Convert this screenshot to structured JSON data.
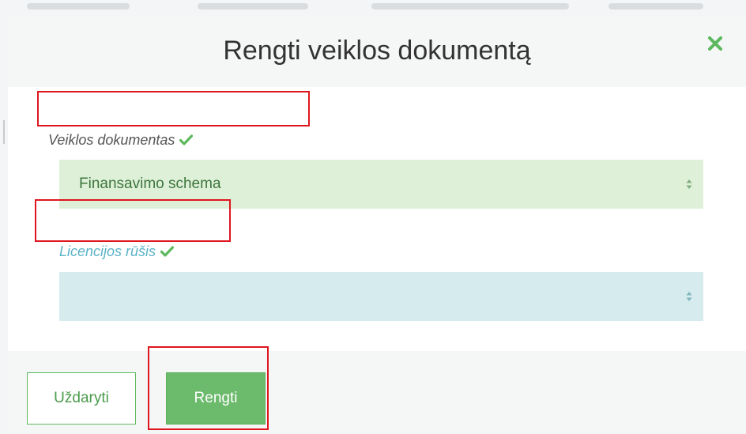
{
  "dialog": {
    "title": "Rengti veiklos dokumentą",
    "close_icon": "close-icon"
  },
  "fields": {
    "document": {
      "label": "Veiklos dokumentas",
      "value": "Finansavimo schema",
      "status_icon": "check-icon"
    },
    "license_type": {
      "label": "Licencijos rūšis",
      "value": "",
      "status_icon": "check-icon"
    }
  },
  "footer": {
    "close_label": "Uždaryti",
    "submit_label": "Rengti"
  },
  "colors": {
    "success_bg": "#dff0d8",
    "info_bg": "#d5ebee",
    "success_text": "#3c763d",
    "info_text": "#5bb3c8",
    "check_green": "#5cb85c",
    "button_green": "#6cba6c",
    "highlight_red": "#e0161e"
  }
}
